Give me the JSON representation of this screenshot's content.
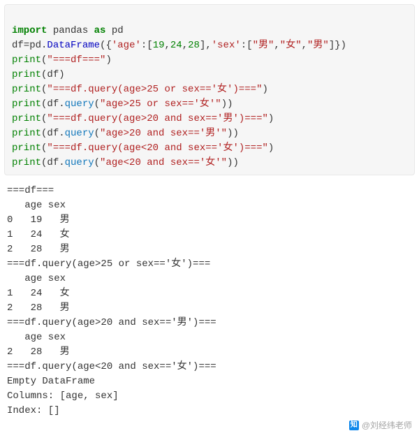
{
  "code": {
    "l1": {
      "import": "import",
      "pandas": "pandas",
      "as": "as",
      "pd": "pd"
    },
    "l2a": "df=pd.",
    "l2b": "DataFrame",
    "l2c": "({",
    "l2d": "'age'",
    "l2e": ":[",
    "l2f": "19",
    "l2g": ",",
    "l2h": "24",
    "l2i": ",",
    "l2j": "28",
    "l2k": "],",
    "l2l": "'sex'",
    "l2m": ":[",
    "l2n": "\"男\"",
    "l2o": ",",
    "l2p": "\"女\"",
    "l2q": ",",
    "l2r": "\"男\"",
    "l2s": "]})",
    "l3a": "print",
    "l3b": "(",
    "l3c": "\"===df===\"",
    "l3d": ")",
    "l4a": "print",
    "l4b": "(df)",
    "l5a": "print",
    "l5b": "(",
    "l5c": "\"===df.query(age>25 or sex=='女')===\"",
    "l5d": ")",
    "l6a": "print",
    "l6b": "(df.",
    "l6c": "query",
    "l6d": "(",
    "l6e": "\"age>25 or sex=='女'\"",
    "l6f": "))",
    "l7a": "print",
    "l7b": "(",
    "l7c": "\"===df.query(age>20 and sex=='男')===\"",
    "l7d": ")",
    "l8a": "print",
    "l8b": "(df.",
    "l8c": "query",
    "l8d": "(",
    "l8e": "\"age>20 and sex=='男'\"",
    "l8f": "))",
    "l9a": "print",
    "l9b": "(",
    "l9c": "\"===df.query(age<20 and sex=='女')===\"",
    "l9d": ")",
    "l10a": "print",
    "l10b": "(df.",
    "l10c": "query",
    "l10d": "(",
    "l10e": "\"age<20 and sex=='女'\"",
    "l10f": "))"
  },
  "output": {
    "text": "===df===\n   age sex\n0   19   男\n1   24   女\n2   28   男\n===df.query(age>25 or sex=='女')===\n   age sex\n1   24   女\n2   28   男\n===df.query(age>20 and sex=='男')===\n   age sex\n2   28   男\n===df.query(age<20 and sex=='女')===\nEmpty DataFrame\nColumns: [age, sex]\nIndex: []"
  },
  "watermark": {
    "icon": "知",
    "text": "@刘经纬老师"
  }
}
